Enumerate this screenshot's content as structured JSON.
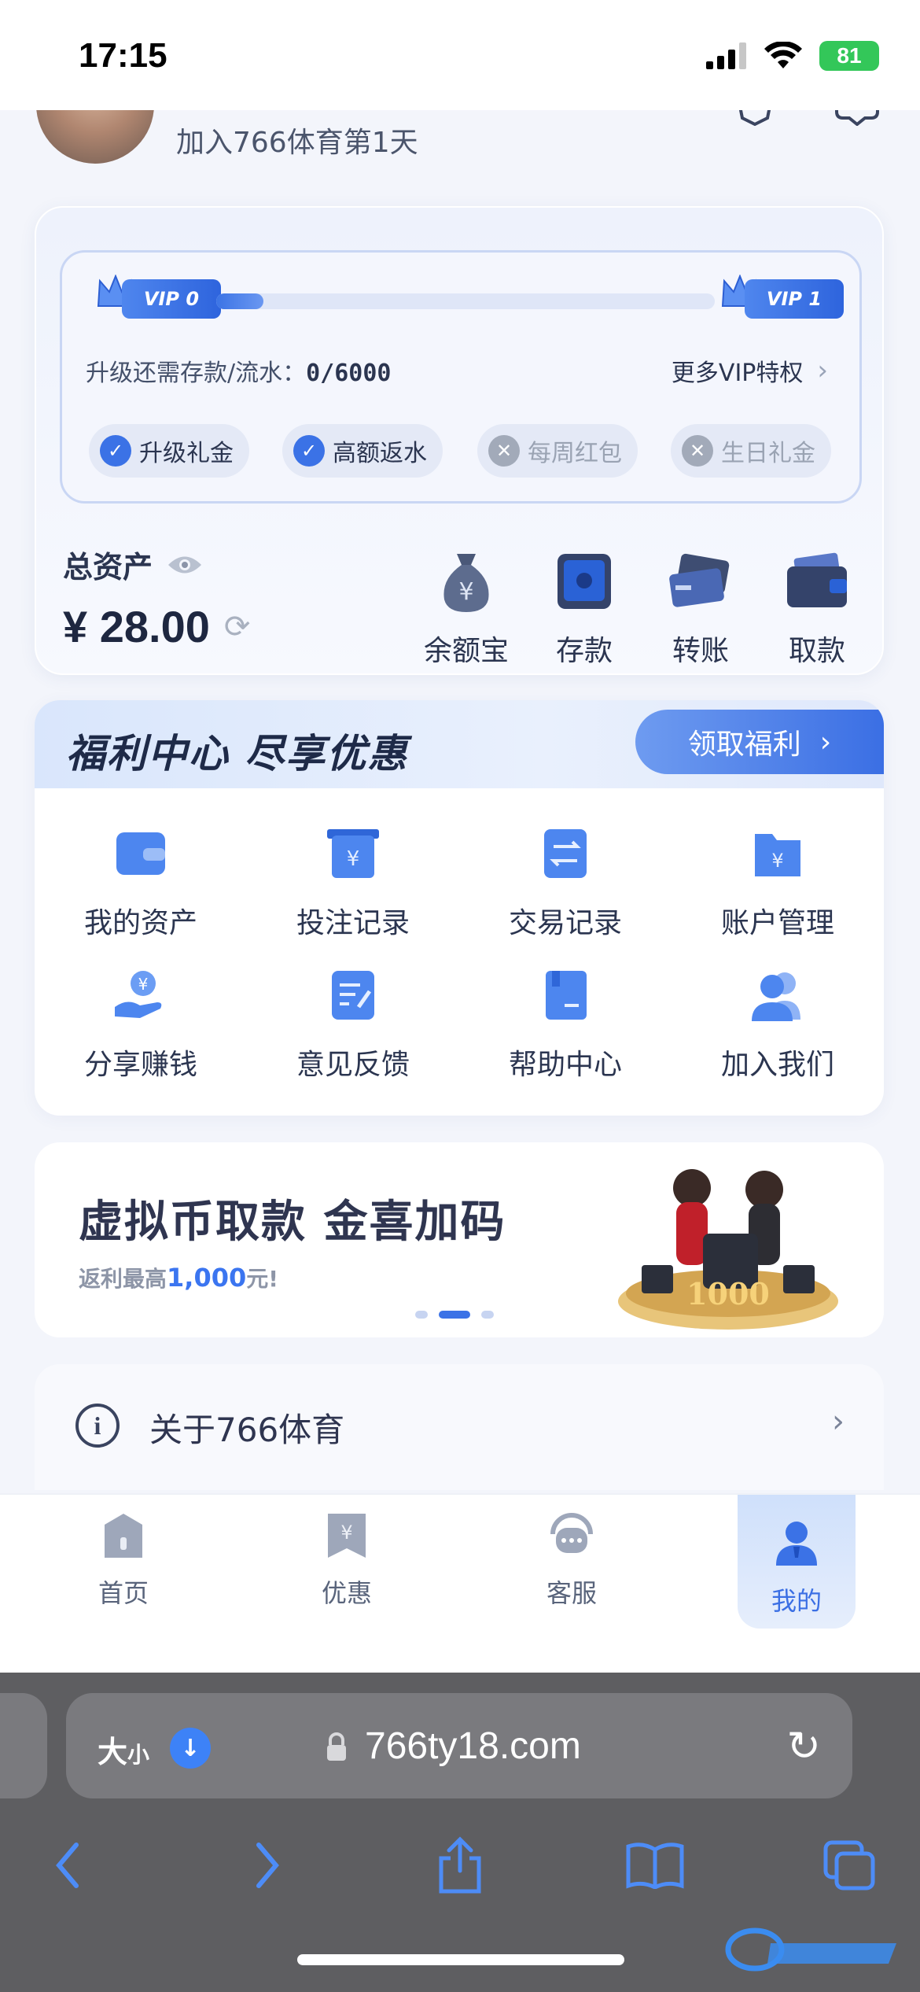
{
  "status_bar": {
    "time": "17:15",
    "battery": "81"
  },
  "profile": {
    "join_text": "加入766体育第1天"
  },
  "vip": {
    "current_badge": "VIP 0",
    "next_badge": "VIP 1",
    "progress_fraction": 0,
    "upgrade_label": "升级还需存款/流水：",
    "upgrade_value": "0/6000",
    "more_label": "更多VIP特权",
    "perks": [
      {
        "label": "升级礼金",
        "unlocked": true
      },
      {
        "label": "高额返水",
        "unlocked": true
      },
      {
        "label": "每周红包",
        "unlocked": false
      },
      {
        "label": "生日礼金",
        "unlocked": false
      }
    ]
  },
  "assets": {
    "total_label": "总资产",
    "currency": "¥",
    "amount": "28.00",
    "actions": [
      {
        "label": "余额宝",
        "icon": "money-bag-icon"
      },
      {
        "label": "存款",
        "icon": "safe-icon"
      },
      {
        "label": "转账",
        "icon": "cards-icon"
      },
      {
        "label": "取款",
        "icon": "wallet-icon"
      }
    ]
  },
  "welfare": {
    "title": "福利中心  尽享优惠",
    "claim_label": "领取福利",
    "items": [
      {
        "label": "我的资产",
        "icon": "wallet-icon"
      },
      {
        "label": "投注记录",
        "icon": "bet-record-icon"
      },
      {
        "label": "交易记录",
        "icon": "transaction-icon"
      },
      {
        "label": "账户管理",
        "icon": "account-folder-icon"
      },
      {
        "label": "分享赚钱",
        "icon": "share-earn-icon"
      },
      {
        "label": "意见反馈",
        "icon": "feedback-icon"
      },
      {
        "label": "帮助中心",
        "icon": "help-book-icon"
      },
      {
        "label": "加入我们",
        "icon": "join-us-icon"
      }
    ]
  },
  "banner": {
    "title": "虚拟币取款 金喜加码",
    "sub_prefix": "返利最高",
    "sub_highlight": "1,000",
    "sub_suffix": "元!",
    "dots": 3,
    "active_dot": 1
  },
  "about": {
    "label": "关于766体育"
  },
  "tabbar": {
    "tabs": [
      {
        "label": "首页",
        "icon": "home-icon",
        "active": false
      },
      {
        "label": "优惠",
        "icon": "promo-icon",
        "active": false
      },
      {
        "label": "客服",
        "icon": "support-icon",
        "active": false
      },
      {
        "label": "我的",
        "icon": "profile-icon",
        "active": true
      }
    ]
  },
  "browser": {
    "text_size_label": "大",
    "text_size_small": "小",
    "url": "766ty18.com"
  },
  "colors": {
    "accent": "#3b72e6",
    "background": "#f3f5fb"
  }
}
